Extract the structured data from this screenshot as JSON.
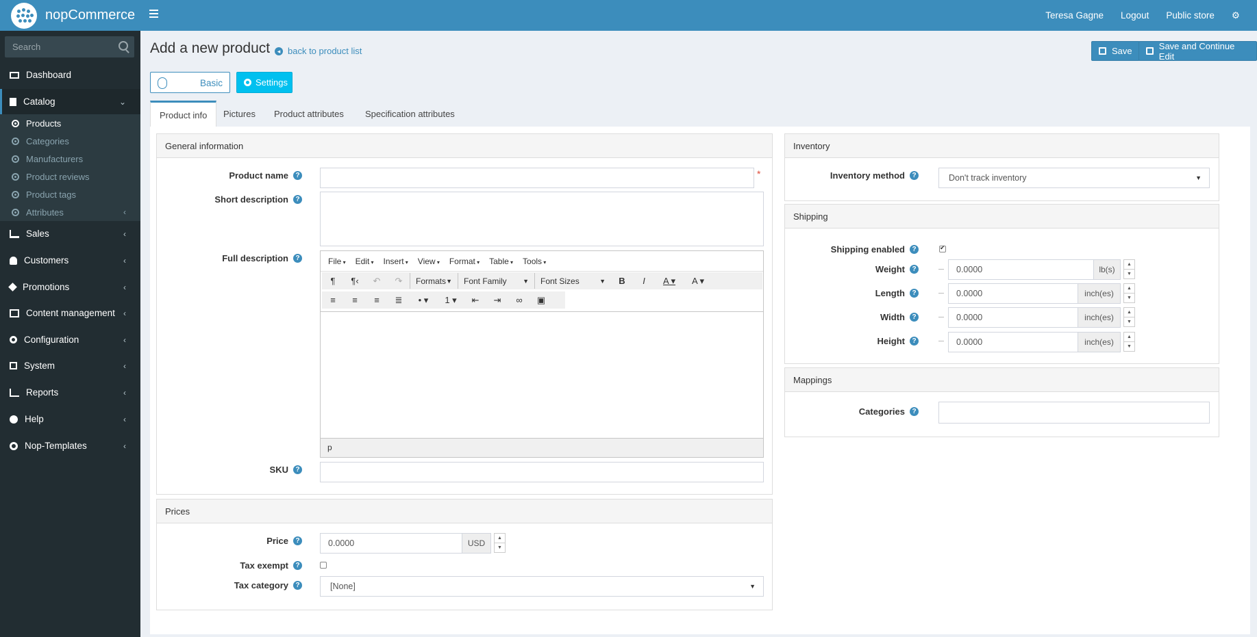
{
  "brand": {
    "name": "nopCommerce"
  },
  "header": {
    "user": "Teresa Gagne",
    "logout": "Logout",
    "public_store": "Public store"
  },
  "sidebar": {
    "search_placeholder": "Search",
    "items": [
      {
        "label": "Dashboard",
        "icon": "monitor-icon"
      },
      {
        "label": "Catalog",
        "icon": "book-icon"
      },
      {
        "label": "Sales",
        "icon": "cart-icon"
      },
      {
        "label": "Customers",
        "icon": "user-icon"
      },
      {
        "label": "Promotions",
        "icon": "tag-icon"
      },
      {
        "label": "Content management",
        "icon": "cubes-icon"
      },
      {
        "label": "Configuration",
        "icon": "gears-icon"
      },
      {
        "label": "System",
        "icon": "cube-icon"
      },
      {
        "label": "Reports",
        "icon": "line-chart-icon"
      },
      {
        "label": "Help",
        "icon": "question-icon"
      },
      {
        "label": "Nop-Templates",
        "icon": "cog-icon"
      }
    ],
    "catalog_sub": [
      "Products",
      "Categories",
      "Manufacturers",
      "Product reviews",
      "Product tags",
      "Attributes"
    ]
  },
  "page": {
    "title": "Add a new product",
    "back_link": "back to product list",
    "save": "Save",
    "save_continue": "Save and Continue Edit",
    "mode_basic": "Basic",
    "settings": "Settings"
  },
  "tabs": [
    "Product info",
    "Pictures",
    "Product attributes",
    "Specification attributes"
  ],
  "general": {
    "title": "General information",
    "product_name": "Product name",
    "short_desc": "Short description",
    "full_desc": "Full description",
    "sku": "SKU"
  },
  "editor": {
    "menus": [
      "File",
      "Edit",
      "Insert",
      "View",
      "Format",
      "Table",
      "Tools"
    ],
    "formats": "Formats",
    "font_family": "Font Family",
    "font_sizes": "Font Sizes",
    "status_path": "p"
  },
  "prices": {
    "title": "Prices",
    "price_label": "Price",
    "price_value": "0.0000",
    "currency": "USD",
    "tax_exempt": "Tax exempt",
    "tax_category": "Tax category",
    "tax_category_value": "[None]"
  },
  "inventory": {
    "title": "Inventory",
    "method_label": "Inventory method",
    "method_value": "Don't track inventory"
  },
  "shipping": {
    "title": "Shipping",
    "enabled_label": "Shipping enabled",
    "enabled": true,
    "weight_label": "Weight",
    "weight_value": "0.0000",
    "weight_unit": "lb(s)",
    "length_label": "Length",
    "length_value": "0.0000",
    "length_unit": "inch(es)",
    "width_label": "Width",
    "width_value": "0.0000",
    "width_unit": "inch(es)",
    "height_label": "Height",
    "height_value": "0.0000",
    "height_unit": "inch(es)"
  },
  "mappings": {
    "title": "Mappings",
    "categories_label": "Categories"
  },
  "colors": {
    "primary": "#3c8dbc",
    "info": "#00c0ef",
    "sidebar": "#222d32",
    "required": "#dd4b39"
  }
}
